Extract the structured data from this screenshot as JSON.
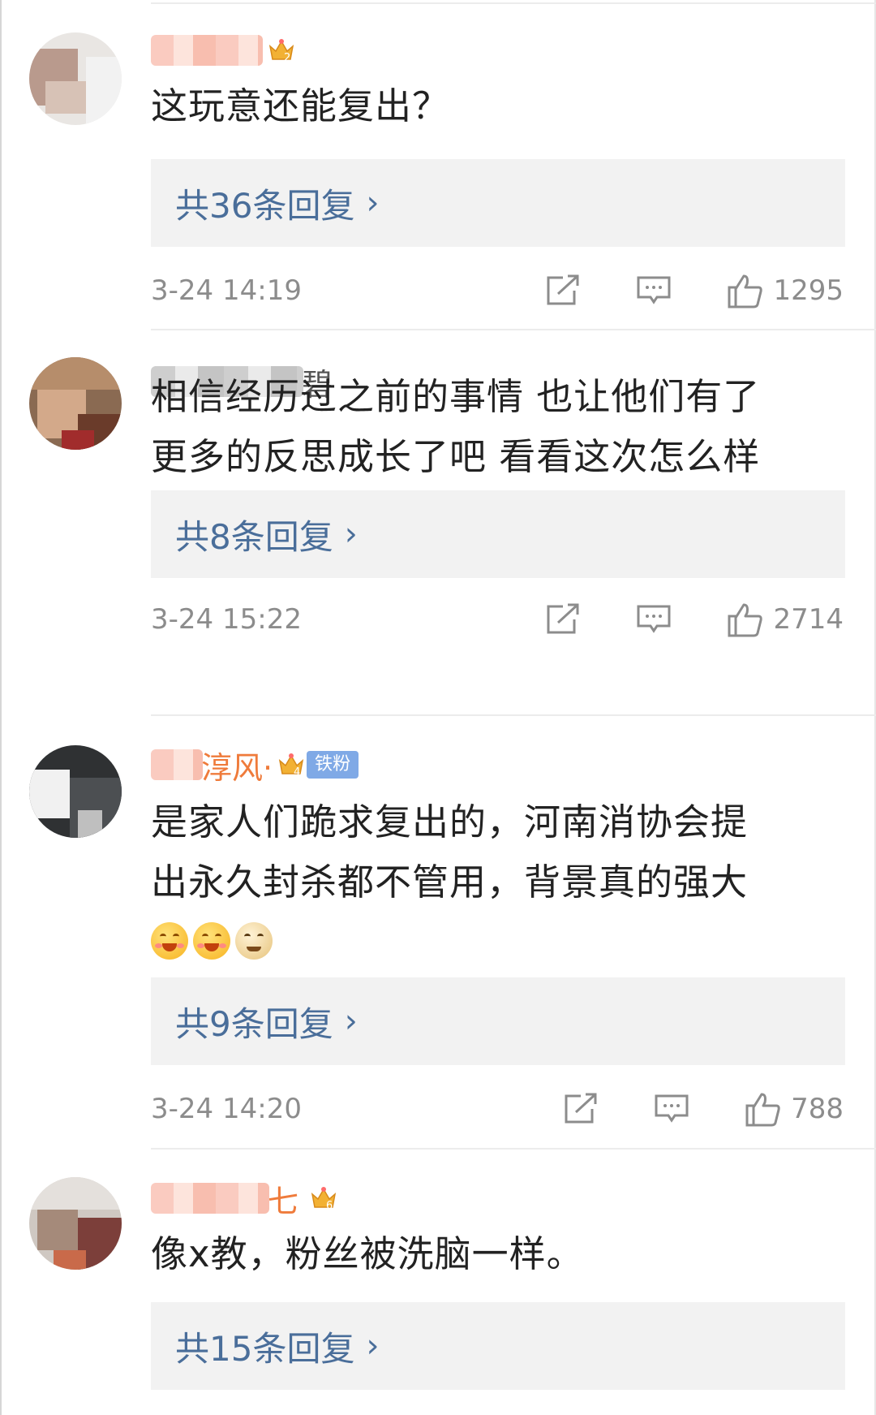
{
  "comments": [
    {
      "name_visible": "",
      "name_tail": "",
      "text": "这玩意还能复出？",
      "replies": "共36条回复",
      "time": "3-24 14:19",
      "likes": "1295",
      "crown_level": "2"
    },
    {
      "name_visible": "",
      "name_tail": "碧",
      "text_lines": [
        "相信经历过之前的事情 也让他们有了",
        "更多的反思成长了吧 看看这次怎么样"
      ],
      "replies": "共8条回复",
      "time": "3-24 15:22",
      "likes": "2714"
    },
    {
      "name_tail": "淳风·",
      "crown_level": "4",
      "badge": "铁粉",
      "text_lines": [
        "是家人们跪求复出的，河南消协会提",
        "出永久封杀都不管用，背景真的强大"
      ],
      "replies": "共9条回复",
      "time": "3-24 14:20",
      "likes": "788"
    },
    {
      "name_tail": "七",
      "crown_level": "6",
      "text": "像x教，粉丝被洗脑一样。",
      "replies": "共15条回复"
    }
  ],
  "icons": {
    "share": "share-icon",
    "comment": "comment-icon",
    "like": "thumbs-up-icon",
    "chevron": "›"
  },
  "colors": {
    "name": "#ef7b3b",
    "reply_link": "#4a6e9a",
    "meta": "#8c8c8c",
    "reply_bg": "#f2f2f2",
    "badge": "#7fa9e6"
  }
}
